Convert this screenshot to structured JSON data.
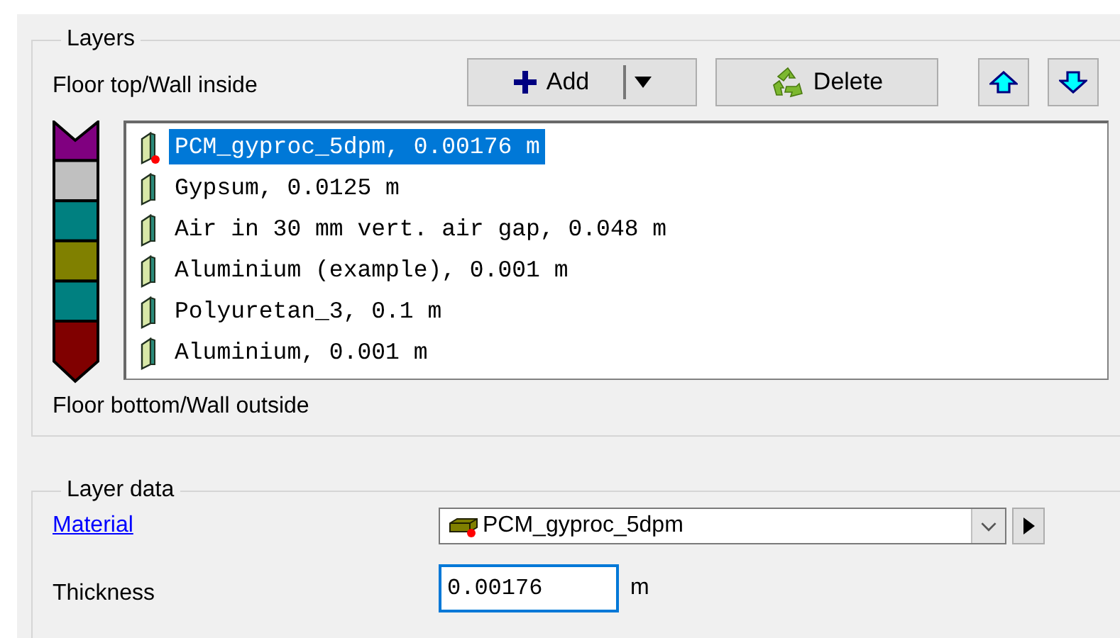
{
  "layers_group": {
    "title": "Layers",
    "top_label": "Floor top/Wall inside",
    "bottom_label": "Floor bottom/Wall outside",
    "buttons": {
      "add": "Add",
      "delete": "Delete"
    },
    "layers": [
      {
        "label": "PCM_gyproc_5dpm, 0.00176 m",
        "color": "#800080",
        "selected": true,
        "marked": true
      },
      {
        "label": "Gypsum, 0.0125 m",
        "color": "#c0c0c0",
        "selected": false,
        "marked": false
      },
      {
        "label": "Air in 30 mm vert. air gap, 0.048 m",
        "color": "#008080",
        "selected": false,
        "marked": false
      },
      {
        "label": "Aluminium (example), 0.001 m",
        "color": "#808000",
        "selected": false,
        "marked": false
      },
      {
        "label": "Polyuretan_3, 0.1 m",
        "color": "#008080",
        "selected": false,
        "marked": false
      },
      {
        "label": "Aluminium, 0.001 m",
        "color": "#800000",
        "selected": false,
        "marked": false
      }
    ]
  },
  "layer_data": {
    "title": "Layer data",
    "material_label": "Material",
    "material_value": "PCM_gyproc_5dpm",
    "material_marked": true,
    "thickness_label": "Thickness",
    "thickness_value": "0.00176",
    "thickness_unit": "m"
  }
}
